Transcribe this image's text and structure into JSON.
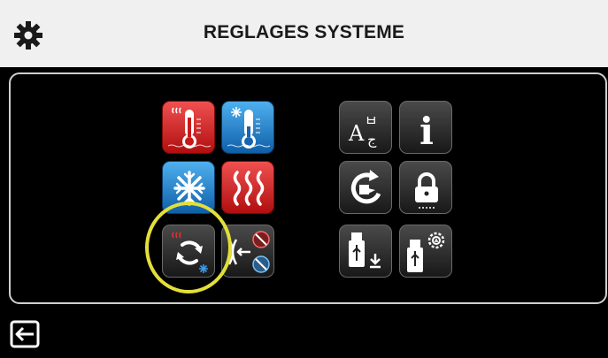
{
  "header": {
    "title": "REGLAGES SYSTEME",
    "settings_icon": "gear-icon"
  },
  "left_grid": {
    "tiles": [
      {
        "name": "heating-thermometer",
        "icon": "heat-thermometer-icon",
        "color": "#d71f1f"
      },
      {
        "name": "cooling-thermometer",
        "icon": "cold-thermometer-icon",
        "color": "#1f7fd1"
      },
      {
        "name": "cooling",
        "icon": "snowflake-icon",
        "color": "#1f7fd1"
      },
      {
        "name": "heating",
        "icon": "heat-waves-icon",
        "color": "#d71f1f"
      },
      {
        "name": "mode-switch",
        "icon": "heat-cool-cycle-icon",
        "color": "#2b2b2b"
      },
      {
        "name": "tube-settings",
        "icon": "tube-no-heat-no-cool-icon",
        "color": "#2b2b2b"
      }
    ]
  },
  "right_grid": {
    "tiles": [
      {
        "name": "language",
        "icon": "language-icon",
        "label": "A",
        "superscript": "ㅂ",
        "subscript": "ج"
      },
      {
        "name": "information",
        "icon": "info-icon",
        "label": "i"
      },
      {
        "name": "reset",
        "icon": "restart-icon"
      },
      {
        "name": "lock",
        "icon": "lock-icon"
      },
      {
        "name": "usb-export",
        "icon": "usb-download-icon"
      },
      {
        "name": "usb-settings",
        "icon": "usb-settings-icon"
      }
    ]
  },
  "footer": {
    "back_icon": "exit-icon"
  },
  "colors": {
    "header_bg": "#f0f0f0",
    "highlight": "#e2df3a",
    "panel_border": "#cfcfcf"
  }
}
